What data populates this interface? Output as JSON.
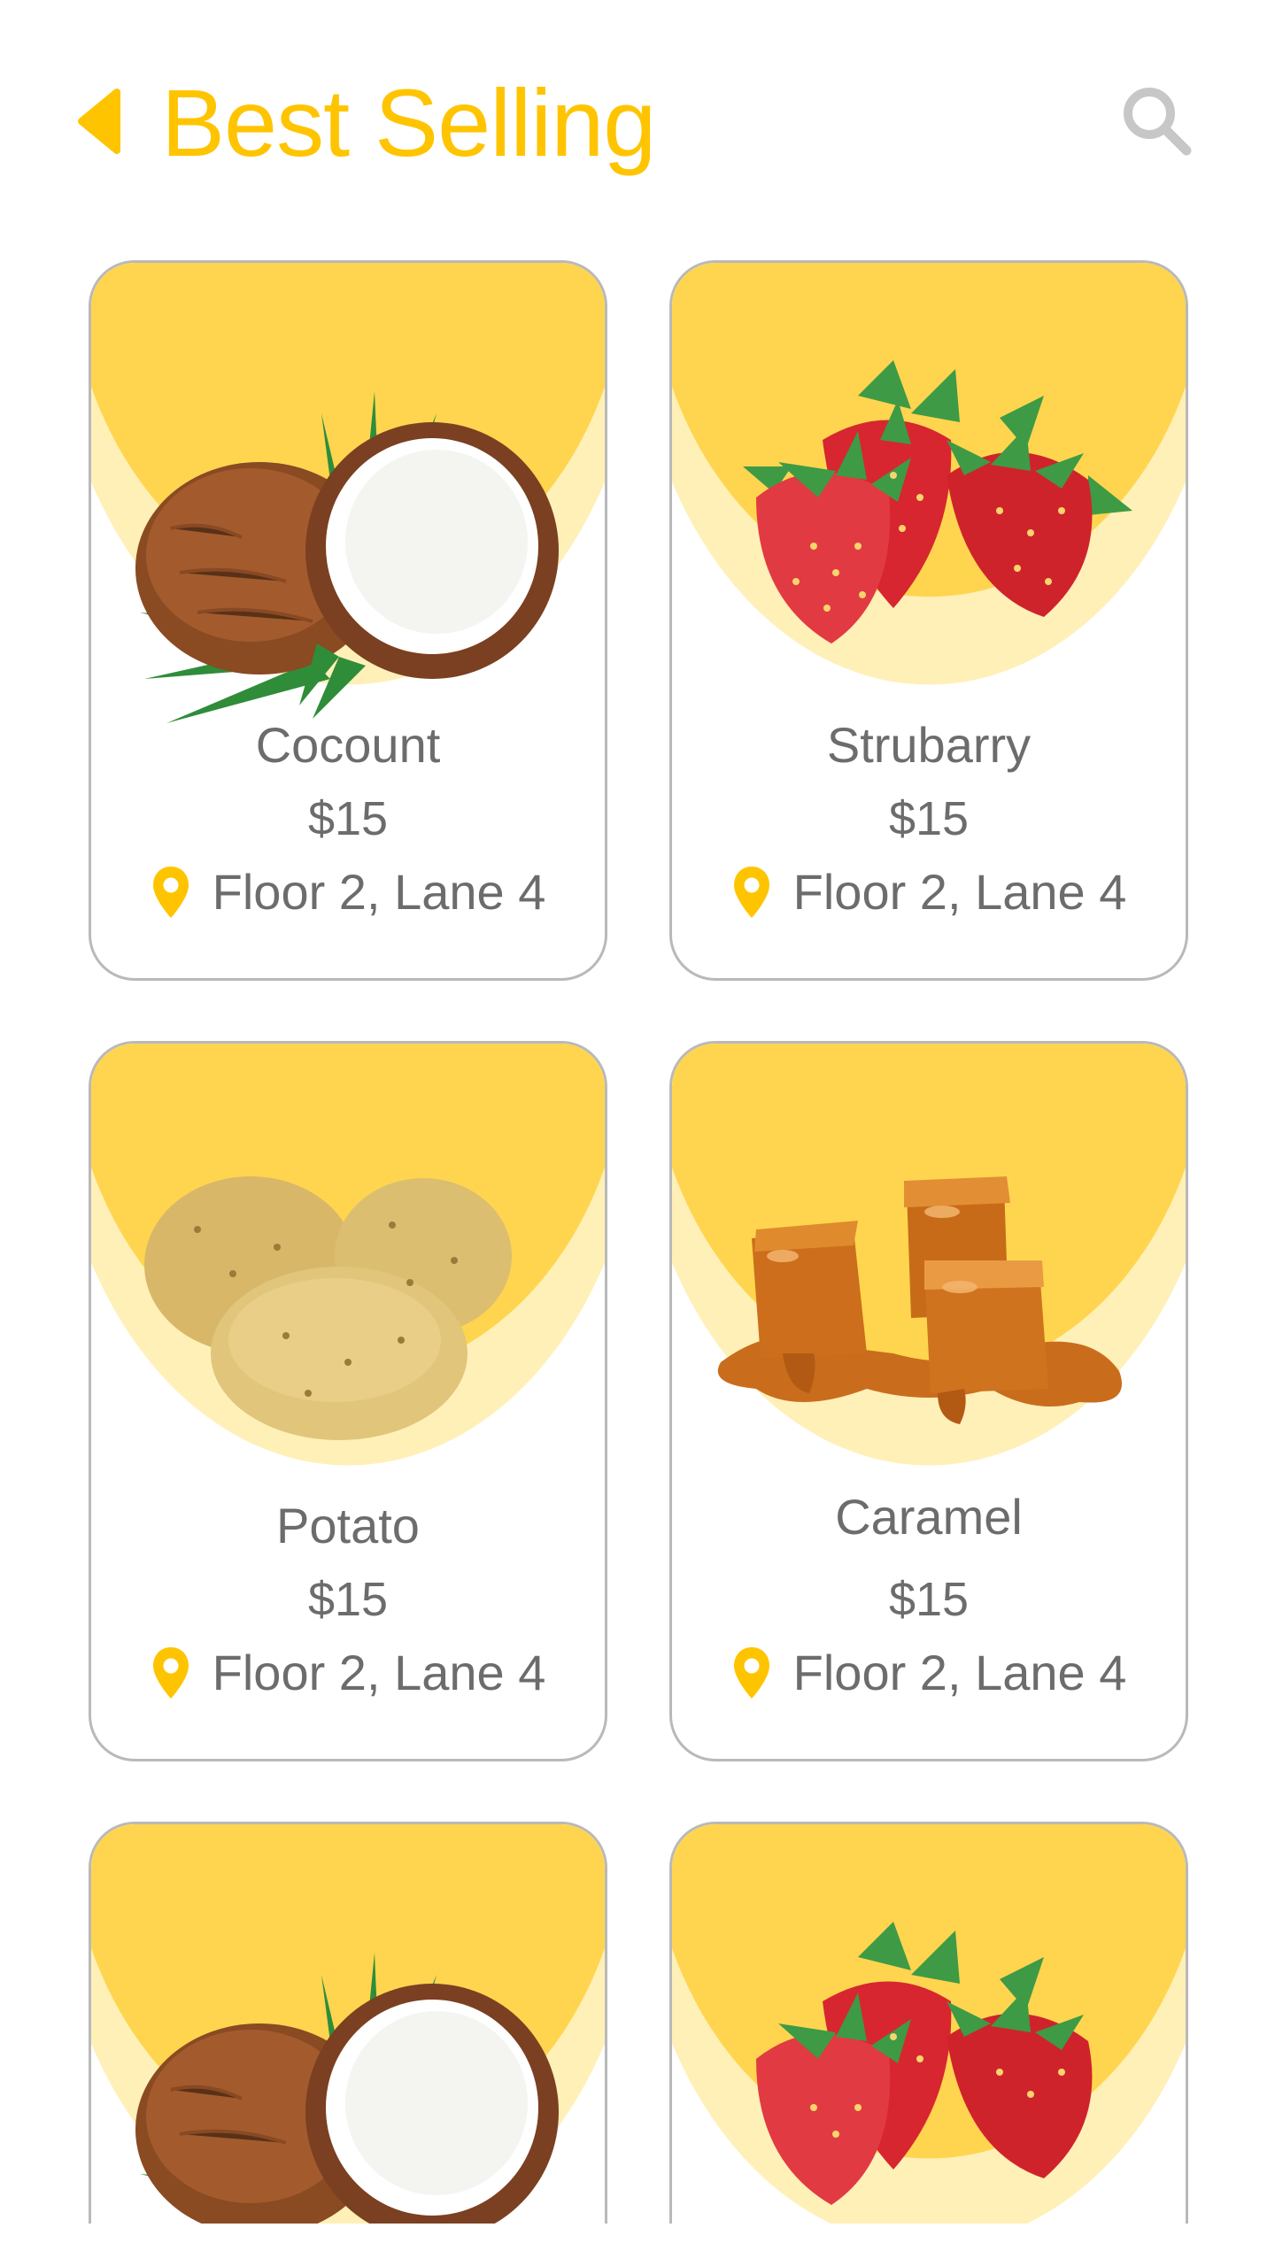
{
  "header": {
    "title": "Best Selling",
    "back_icon": "back-arrow-icon",
    "search_icon": "search-icon"
  },
  "colors": {
    "accent": "#ffc400",
    "card_wash": "#ffd54f",
    "card_wash_light": "#fff0b8",
    "text": "#6c6c6c",
    "border": "#b9b9b9"
  },
  "products": [
    {
      "name": "Cocount",
      "price": "$15",
      "location": "Floor 2, Lane 4",
      "image": "coconut-image",
      "location_icon": "location-pin-icon"
    },
    {
      "name": "Strubarry",
      "price": "$15",
      "location": "Floor 2, Lane 4",
      "image": "strawberry-image",
      "location_icon": "location-pin-icon"
    },
    {
      "name": "Potato",
      "price": "$15",
      "location": "Floor 2, Lane 4",
      "image": "potato-image",
      "location_icon": "location-pin-icon"
    },
    {
      "name": "Caramel",
      "price": "$15",
      "location": "Floor 2, Lane 4",
      "image": "caramel-image",
      "location_icon": "location-pin-icon"
    },
    {
      "name": "",
      "price": "",
      "location": "",
      "image": "coconut-image"
    },
    {
      "name": "",
      "price": "",
      "location": "",
      "image": "strawberry-image"
    }
  ]
}
